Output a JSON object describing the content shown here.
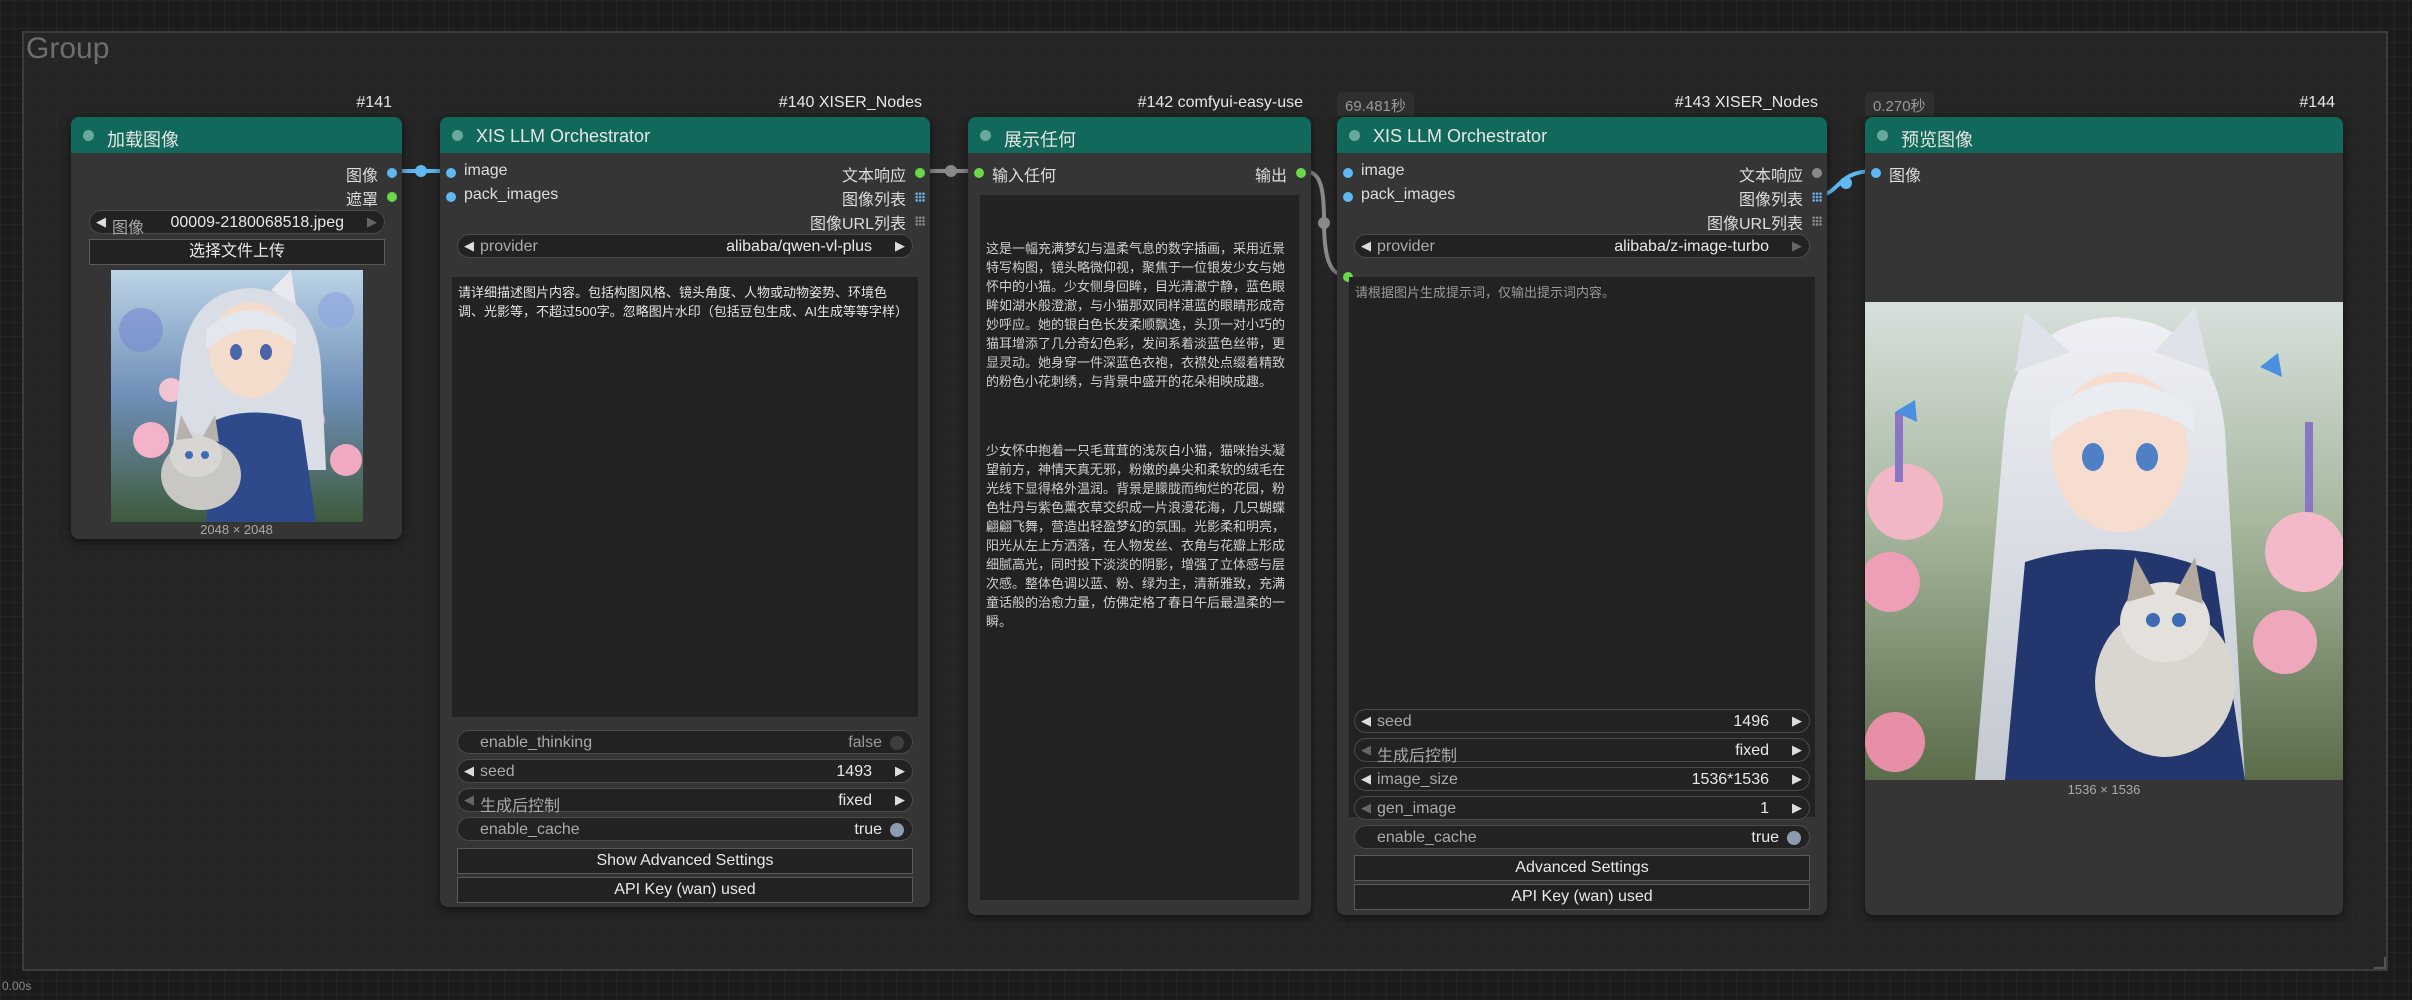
{
  "group": {
    "title": "Group"
  },
  "status": "0.00s",
  "nodes": {
    "load": {
      "badge": "#141",
      "title": "加载图像",
      "outputs": [
        "图像",
        "遮罩"
      ],
      "image_widget": {
        "label": "图像",
        "value": "00009-2180068518.jpeg"
      },
      "upload_label": "选择文件上传",
      "dims": "2048 × 2048"
    },
    "llm1": {
      "badge": "#140 XISER_Nodes",
      "title": "XIS LLM Orchestrator",
      "inputs": [
        "image",
        "pack_images"
      ],
      "outputs": [
        "文本响应",
        "图像列表",
        "图像URL列表"
      ],
      "provider": {
        "label": "provider",
        "value": "alibaba/qwen-vl-plus"
      },
      "prompt": "请详细描述图片内容。包括构图风格、镜头角度、人物或动物姿势、环境色调、光影等，不超过500字。忽略图片水印（包括豆包生成、AI生成等等字样）",
      "enable_thinking": {
        "label": "enable_thinking",
        "value": "false"
      },
      "seed": {
        "label": "seed",
        "value": "1493"
      },
      "after": {
        "label": "生成后控制",
        "value": "fixed"
      },
      "enable_cache": {
        "label": "enable_cache",
        "value": "true"
      },
      "btn_advanced": "Show Advanced Settings",
      "btn_api": "API Key (wan) used"
    },
    "show": {
      "badge": "#142 comfyui-easy-use",
      "title": "展示任何",
      "input": "输入任何",
      "output": "输出",
      "para1": "这是一幅充满梦幻与温柔气息的数字插画，采用近景特写构图，镜头略微仰视，聚焦于一位银发少女与她怀中的小猫。少女侧身回眸，目光清澈宁静，蓝色眼眸如湖水般澄澈，与小猫那双同样湛蓝的眼睛形成奇妙呼应。她的银白色长发柔顺飘逸，头顶一对小巧的猫耳增添了几分奇幻色彩，发间系着淡蓝色丝带，更显灵动。她身穿一件深蓝色衣袍，衣襟处点缀着精致的粉色小花刺绣，与背景中盛开的花朵相映成趣。",
      "para2": "少女怀中抱着一只毛茸茸的浅灰白小猫，猫咪抬头凝望前方，神情天真无邪，粉嫩的鼻尖和柔软的绒毛在光线下显得格外温润。背景是朦胧而绚烂的花园，粉色牡丹与紫色薰衣草交织成一片浪漫花海，几只蝴蝶翩翩飞舞，营造出轻盈梦幻的氛围。光影柔和明亮，阳光从左上方洒落，在人物发丝、衣角与花瓣上形成细腻高光，同时投下淡淡的阴影，增强了立体感与层次感。整体色调以蓝、粉、绿为主，清新雅致，充满童话般的治愈力量，仿佛定格了春日午后最温柔的一瞬。"
    },
    "llm2": {
      "time": "69.481秒",
      "badge": "#143 XISER_Nodes",
      "title": "XIS LLM Orchestrator",
      "inputs": [
        "image",
        "pack_images"
      ],
      "outputs": [
        "文本响应",
        "图像列表",
        "图像URL列表"
      ],
      "provider": {
        "label": "provider",
        "value": "alibaba/z-image-turbo"
      },
      "prompt": "请根据图片生成提示词，仅输出提示词内容。",
      "seed": {
        "label": "seed",
        "value": "1496"
      },
      "after": {
        "label": "生成后控制",
        "value": "fixed"
      },
      "image_size": {
        "label": "image_size",
        "value": "1536*1536"
      },
      "gen_image": {
        "label": "gen_image",
        "value": "1"
      },
      "enable_cache": {
        "label": "enable_cache",
        "value": "true"
      },
      "btn_advanced": "Advanced Settings",
      "btn_api": "API Key (wan) used"
    },
    "preview": {
      "time": "0.270秒",
      "badge": "#144",
      "title": "预览图像",
      "input": "图像",
      "dims": "1536 × 1536"
    }
  },
  "colors": {
    "node_header": "#10695a",
    "image_port": "#5fb8f0",
    "string_port": "#6bd84a",
    "node_bg": "#353535"
  }
}
